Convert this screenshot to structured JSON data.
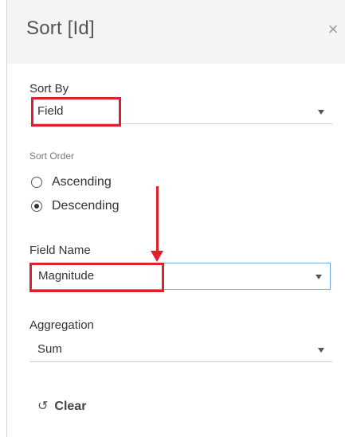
{
  "dialog": {
    "title": "Sort [Id]",
    "close_symbol": "×"
  },
  "sort_by": {
    "label": "Sort By",
    "value": "Field"
  },
  "sort_order": {
    "label": "Sort Order",
    "options": [
      {
        "label": "Ascending",
        "selected": false
      },
      {
        "label": "Descending",
        "selected": true
      }
    ]
  },
  "field_name": {
    "label": "Field Name",
    "value": "Magnitude"
  },
  "aggregation": {
    "label": "Aggregation",
    "value": "Sum"
  },
  "clear": {
    "icon": "undo-icon",
    "icon_glyph": "↺",
    "label": "Clear"
  },
  "annotation_color": "#e0212b",
  "focus_color": "#6aa9d9"
}
